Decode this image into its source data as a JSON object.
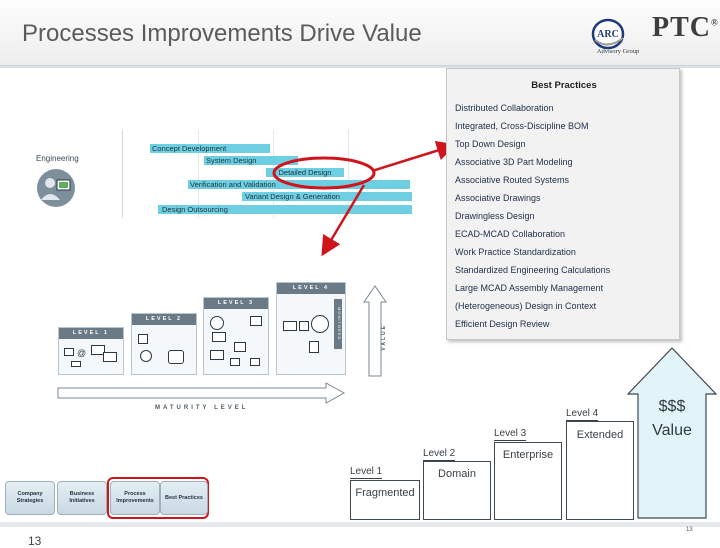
{
  "header": {
    "title": "Processes Improvements Drive Value",
    "arc_logo_text": "ARC",
    "arc_logo_sub": "Advisory Group",
    "ptc_logo_text": "PTC",
    "ptc_logo_mark": "®"
  },
  "engineering": {
    "label": "Engineering",
    "bars": [
      "Concept Development",
      "System Design",
      "Detailed Design",
      "Verification and Validation",
      "Variant Design & Generation",
      "Design Outsourcing"
    ]
  },
  "best_practices": {
    "heading": "Best Practices",
    "items": [
      "Distributed Collaboration",
      "Integrated, Cross-Discipline BOM",
      "Top Down Design",
      "Associative 3D Part Modeling",
      "Associative Routed Systems",
      "Associative Drawings",
      "Drawingless Design",
      "ECAD-MCAD Collaboration",
      "Work Practice Standardization",
      "Standardized Engineering Calculations",
      "Large MCAD Assembly Management",
      "(Heterogeneous) Design in Context",
      "Efficient Design Review"
    ]
  },
  "maturity_diagram": {
    "levels": [
      "LEVEL 1",
      "LEVEL 2",
      "LEVEL 3",
      "LEVEL 4"
    ],
    "axis_x": "MATURITY LEVEL",
    "axis_y": "VALUE",
    "sidebar_tag": "MONITORED"
  },
  "nav": {
    "tabs": [
      "Company Strategies",
      "Business Initiatives",
      "Process Improvements",
      "Best Practices"
    ]
  },
  "staircase": {
    "steps": [
      {
        "level": "Level 1",
        "name": "Fragmented"
      },
      {
        "level": "Level 2",
        "name": "Domain"
      },
      {
        "level": "Level 3",
        "name": "Enterprise"
      },
      {
        "level": "Level 4",
        "name": "Extended"
      }
    ],
    "value_line1": "$$$",
    "value_line2": "Value"
  },
  "footer": {
    "page_number": "13",
    "left_number": "13"
  },
  "colors": {
    "highlight_red": "#d0141c",
    "bar_cyan": "#6fcfe2",
    "value_arrow_fill": "#e3f3fa"
  }
}
